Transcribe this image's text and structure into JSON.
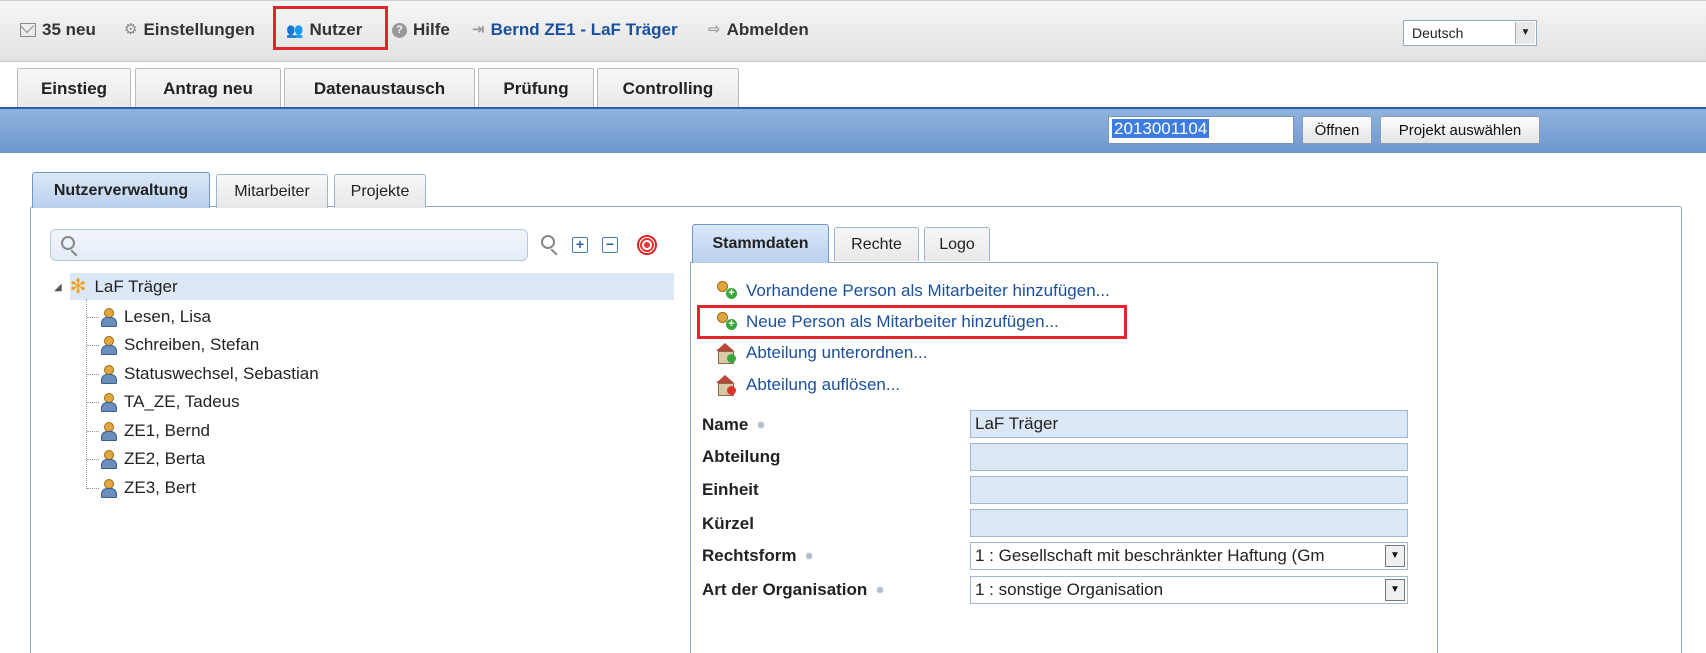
{
  "topbar": {
    "messages": "35 neu",
    "settings": "Einstellungen",
    "users": "Nutzer",
    "help": "Hilfe",
    "user_link": "Bernd ZE1 - LaF Träger",
    "logout": "Abmelden",
    "language": "Deutsch"
  },
  "main_tabs": [
    "Einstieg",
    "Antrag neu",
    "Datenaustausch",
    "Prüfung",
    "Controlling"
  ],
  "project_bar": {
    "project_number": "2013001104",
    "open_button": "Öffnen",
    "select_button": "Projekt auswählen"
  },
  "sub_tabs": [
    "Nutzerverwaltung",
    "Mitarbeiter",
    "Projekte"
  ],
  "tree": {
    "root": "LaF Träger",
    "people": [
      "Lesen, Lisa",
      "Schreiben, Stefan",
      "Statuswechsel, Sebastian",
      "TA_ZE, Tadeus",
      "ZE1, Bernd",
      "ZE2, Berta",
      "ZE3, Bert"
    ]
  },
  "detail_tabs": [
    "Stammdaten",
    "Rechte",
    "Logo"
  ],
  "actions": [
    "Vorhandene Person als Mitarbeiter hinzufügen...",
    "Neue Person als Mitarbeiter hinzufügen...",
    "Abteilung unterordnen...",
    "Abteilung auflösen..."
  ],
  "form": {
    "name_label": "Name",
    "name_value": "LaF Träger",
    "abteilung_label": "Abteilung",
    "abteilung_value": "",
    "einheit_label": "Einheit",
    "einheit_value": "",
    "kuerzel_label": "Kürzel",
    "kuerzel_value": "",
    "rechtsform_label": "Rechtsform",
    "rechtsform_value": "1 : Gesellschaft mit beschränkter Haftung (Gm",
    "art_label": "Art der Organisation",
    "art_value": "1 : sonstige Organisation"
  },
  "colors": {
    "accent_blue": "#2c5fa8",
    "link_blue": "#1a4f9c",
    "highlight_red": "#e2242c",
    "project_bar": "#7ea5d6"
  }
}
